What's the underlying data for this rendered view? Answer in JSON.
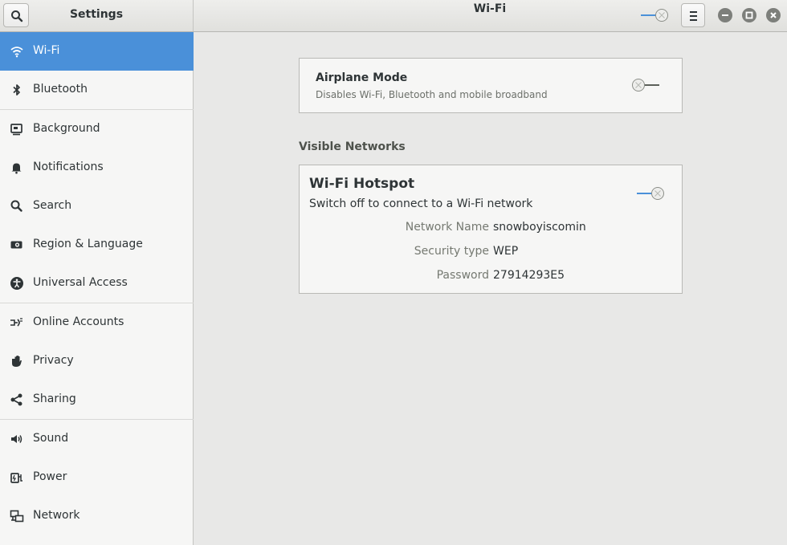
{
  "header": {
    "app_title": "Settings",
    "page_title": "Wi-Fi",
    "search_icon": "search-icon",
    "menu_icon": "hamburger-menu-icon",
    "window_controls": [
      "minimize-icon",
      "maximize-icon",
      "close-icon"
    ],
    "wifi_switch_state": "on"
  },
  "sidebar": {
    "items": [
      {
        "label": "Wi-Fi",
        "icon": "wifi-icon",
        "active": true
      },
      {
        "label": "Bluetooth",
        "icon": "bluetooth-icon"
      },
      {
        "label": "Background",
        "icon": "background-icon"
      },
      {
        "label": "Notifications",
        "icon": "bell-icon"
      },
      {
        "label": "Search",
        "icon": "search-icon"
      },
      {
        "label": "Region & Language",
        "icon": "camera-icon"
      },
      {
        "label": "Universal Access",
        "icon": "accessibility-icon"
      },
      {
        "label": "Online Accounts",
        "icon": "online-accounts-icon"
      },
      {
        "label": "Privacy",
        "icon": "hand-icon"
      },
      {
        "label": "Sharing",
        "icon": "share-icon"
      },
      {
        "label": "Sound",
        "icon": "speaker-icon"
      },
      {
        "label": "Power",
        "icon": "power-plug-icon"
      },
      {
        "label": "Network",
        "icon": "network-icon"
      }
    ]
  },
  "airplane": {
    "title": "Airplane Mode",
    "subtitle": "Disables Wi-Fi, Bluetooth and mobile broadband",
    "switch_state": "off"
  },
  "visible_networks": {
    "title": "Visible Networks"
  },
  "hotspot": {
    "title": "Wi-Fi Hotspot",
    "subtitle": "Switch off to connect to a Wi-Fi network",
    "switch_state": "on",
    "network_name_label": "Network Name",
    "network_name": "snowboyiscomin",
    "security_label": "Security type",
    "security": "WEP",
    "password_label": "Password",
    "password": "27914293E5"
  },
  "colors": {
    "accent": "#4a90d9",
    "sidebar_bg": "#f6f6f5",
    "content_bg": "#e8e8e7"
  }
}
